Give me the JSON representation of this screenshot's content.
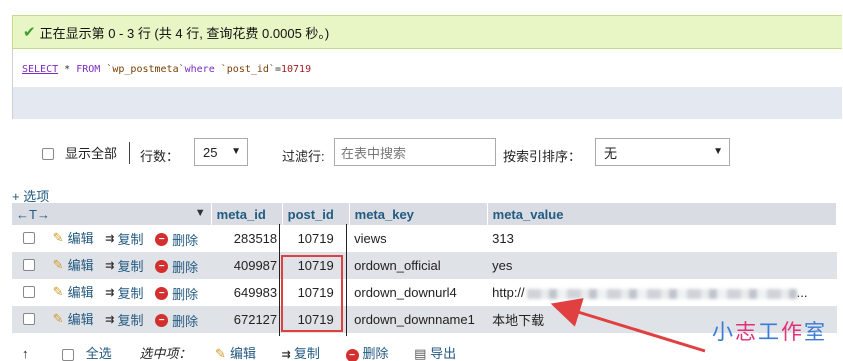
{
  "status": {
    "message": "正在显示第 0 - 3 行 (共 4 行, 查询花费 0.0005 秒。)"
  },
  "sql": {
    "select": "SELECT",
    "star": "*",
    "from": "FROM",
    "table": "`wp_postmeta`",
    "where": "where",
    "column": "`post_id`",
    "op": "=",
    "value": "10719"
  },
  "controls": {
    "show_all": "显示全部",
    "rows_label": "行数：",
    "rows_value": "25",
    "filter_label": "过滤行:",
    "filter_placeholder": "在表中搜索",
    "sort_label": "按索引排序：",
    "sort_value": "无"
  },
  "options_link": "+ 选项",
  "table": {
    "nav_arrows": "←T→",
    "sort_arrow": "▼",
    "headers": [
      "meta_id",
      "post_id",
      "meta_key",
      "meta_value"
    ],
    "actions": {
      "edit": "编辑",
      "copy": "复制",
      "delete": "删除"
    },
    "rows": [
      {
        "meta_id": "283518",
        "post_id": "10719",
        "meta_key": "views",
        "meta_value": "313"
      },
      {
        "meta_id": "409987",
        "post_id": "10719",
        "meta_key": "ordown_official",
        "meta_value": "yes"
      },
      {
        "meta_id": "649983",
        "post_id": "10719",
        "meta_key": "ordown_downurl4",
        "meta_value": "http://",
        "meta_value_suffix": "..."
      },
      {
        "meta_id": "672127",
        "post_id": "10719",
        "meta_key": "ordown_downname1",
        "meta_value": "本地下载"
      }
    ]
  },
  "watermark": {
    "text1": "小",
    "text2": "志",
    "text3": "工",
    "text4": "作",
    "text5": "室",
    "color_a": "#3a7bd5",
    "color_b": "#e0307a"
  },
  "bottom_bar": {
    "up_arrow": "↑",
    "select_all": "全选",
    "selected_label": "选中项：",
    "edit": "编辑",
    "copy": "复制",
    "delete": "删除",
    "export": "导出"
  },
  "colors": {
    "success_bg": "#e8f5c5",
    "link": "#235a81",
    "highlight_box": "#e04040"
  }
}
